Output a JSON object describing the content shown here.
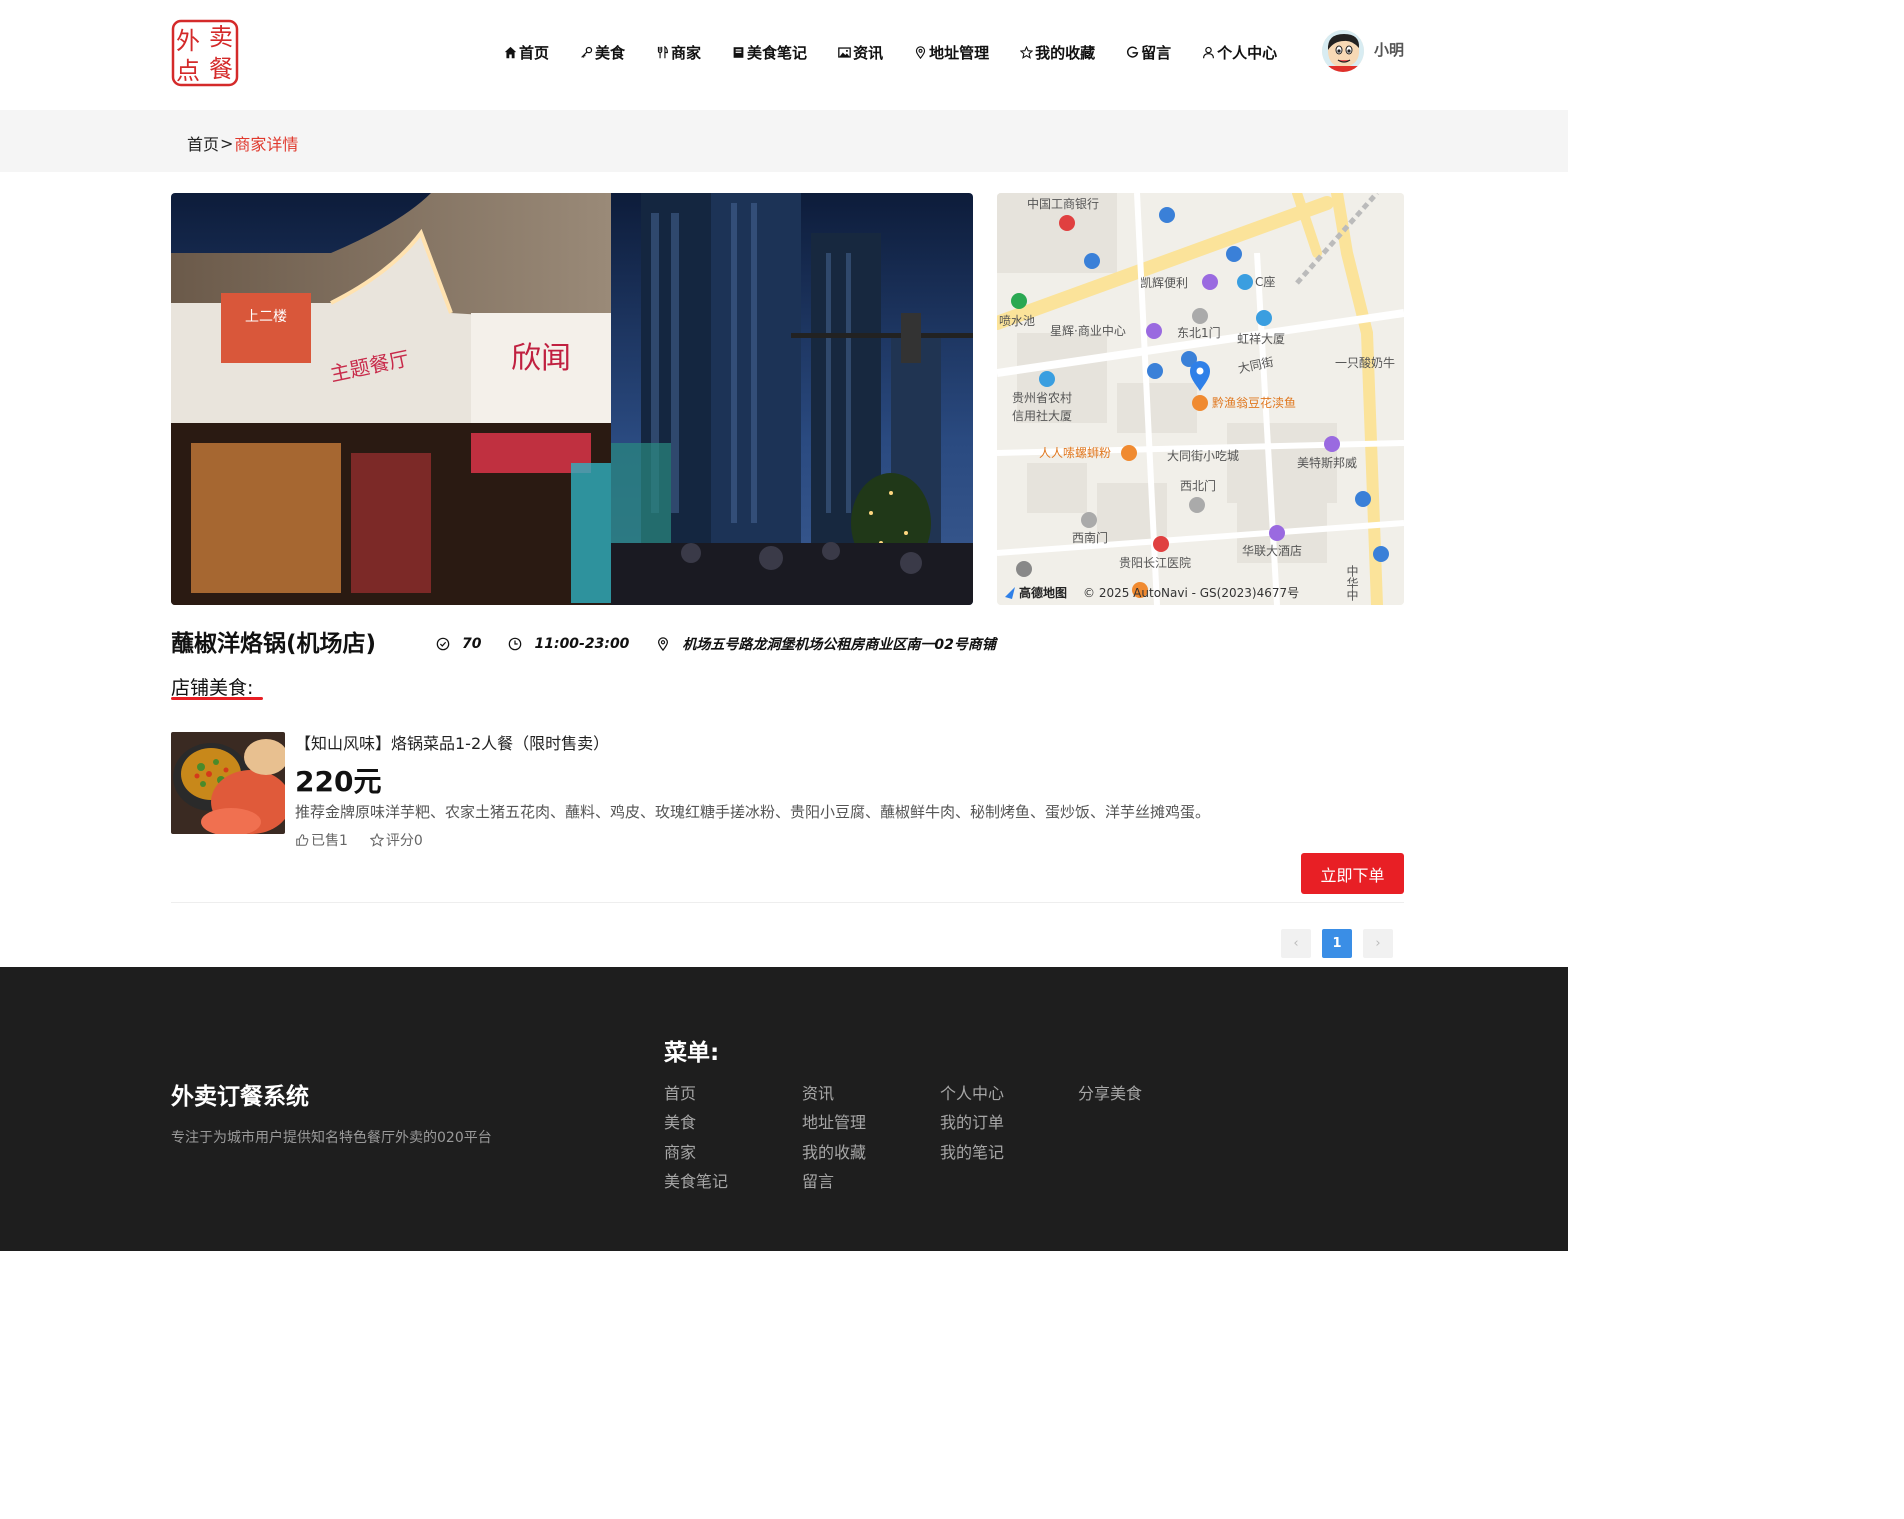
{
  "header": {
    "logo_text": [
      "外",
      "卖",
      "点",
      "餐"
    ],
    "nav": [
      {
        "label": "首页",
        "icon": "home-icon"
      },
      {
        "label": "美食",
        "icon": "key-icon"
      },
      {
        "label": "商家",
        "icon": "fork-knife-icon"
      },
      {
        "label": "美食笔记",
        "icon": "book-icon"
      },
      {
        "label": "资讯",
        "icon": "image-icon"
      },
      {
        "label": "地址管理",
        "icon": "location-pin-icon"
      },
      {
        "label": "我的收藏",
        "icon": "star-icon"
      },
      {
        "label": "留言",
        "icon": "message-icon"
      },
      {
        "label": "个人中心",
        "icon": "user-icon"
      }
    ],
    "username": "小明"
  },
  "breadcrumb": {
    "home": "首页",
    "separator": ">",
    "current": "商家详情"
  },
  "store": {
    "name": "蘸椒洋烙锅(机场店)",
    "rating": "70",
    "hours": "11:00-23:00",
    "address": "机场五号路龙洞堡机场公租房商业区南一02号商铺"
  },
  "map": {
    "labels": [
      "中国工商银行",
      "凯辉便利",
      "C座",
      "喷水池",
      "星辉·商业中心",
      "东北1门",
      "虹祥大厦",
      "大同街",
      "一只酸奶牛",
      "贵州省农村",
      "信用社大厦",
      "黔渔翁豆花渎鱼",
      "人人嗦螺蛳粉",
      "大同街小吃城",
      "美特斯邦威",
      "西北门",
      "西南门",
      "贵阳长江医院",
      "华联大酒店",
      "中华中"
    ],
    "copyright": "© 2025 AutoNavi - GS(2023)4677号",
    "brand": "高德地图"
  },
  "section_title": "店铺美食:",
  "foods": [
    {
      "name": "【知山风味】烙锅菜品1-2人餐（限时售卖）",
      "price": "220元",
      "description": "推荐金牌原味洋芋粑、农家土猪五花肉、蘸料、鸡皮、玫瑰红糖手搓冰粉、贵阳小豆腐、蘸椒鲜牛肉、秘制烤鱼、蛋炒饭、洋芋丝摊鸡蛋。",
      "sold": "已售1",
      "score": "评分0",
      "order_label": "立即下单"
    }
  ],
  "pagination": {
    "prev": "‹",
    "current": "1",
    "next": "›"
  },
  "footer": {
    "title": "外卖订餐系统",
    "description": "专注于为城市用户提供知名特色餐厅外卖的020平台",
    "menu_title": "菜单:",
    "menu_columns": [
      [
        "首页",
        "美食",
        "商家",
        "美食笔记"
      ],
      [
        "资讯",
        "地址管理",
        "我的收藏",
        "留言"
      ],
      [
        "个人中心",
        "我的订单",
        "我的笔记"
      ],
      [
        "分享美食"
      ]
    ]
  },
  "colors": {
    "accent": "#e81f25",
    "page_link": "#3a8ee6",
    "breadcrumb_current": "#e0392d"
  }
}
